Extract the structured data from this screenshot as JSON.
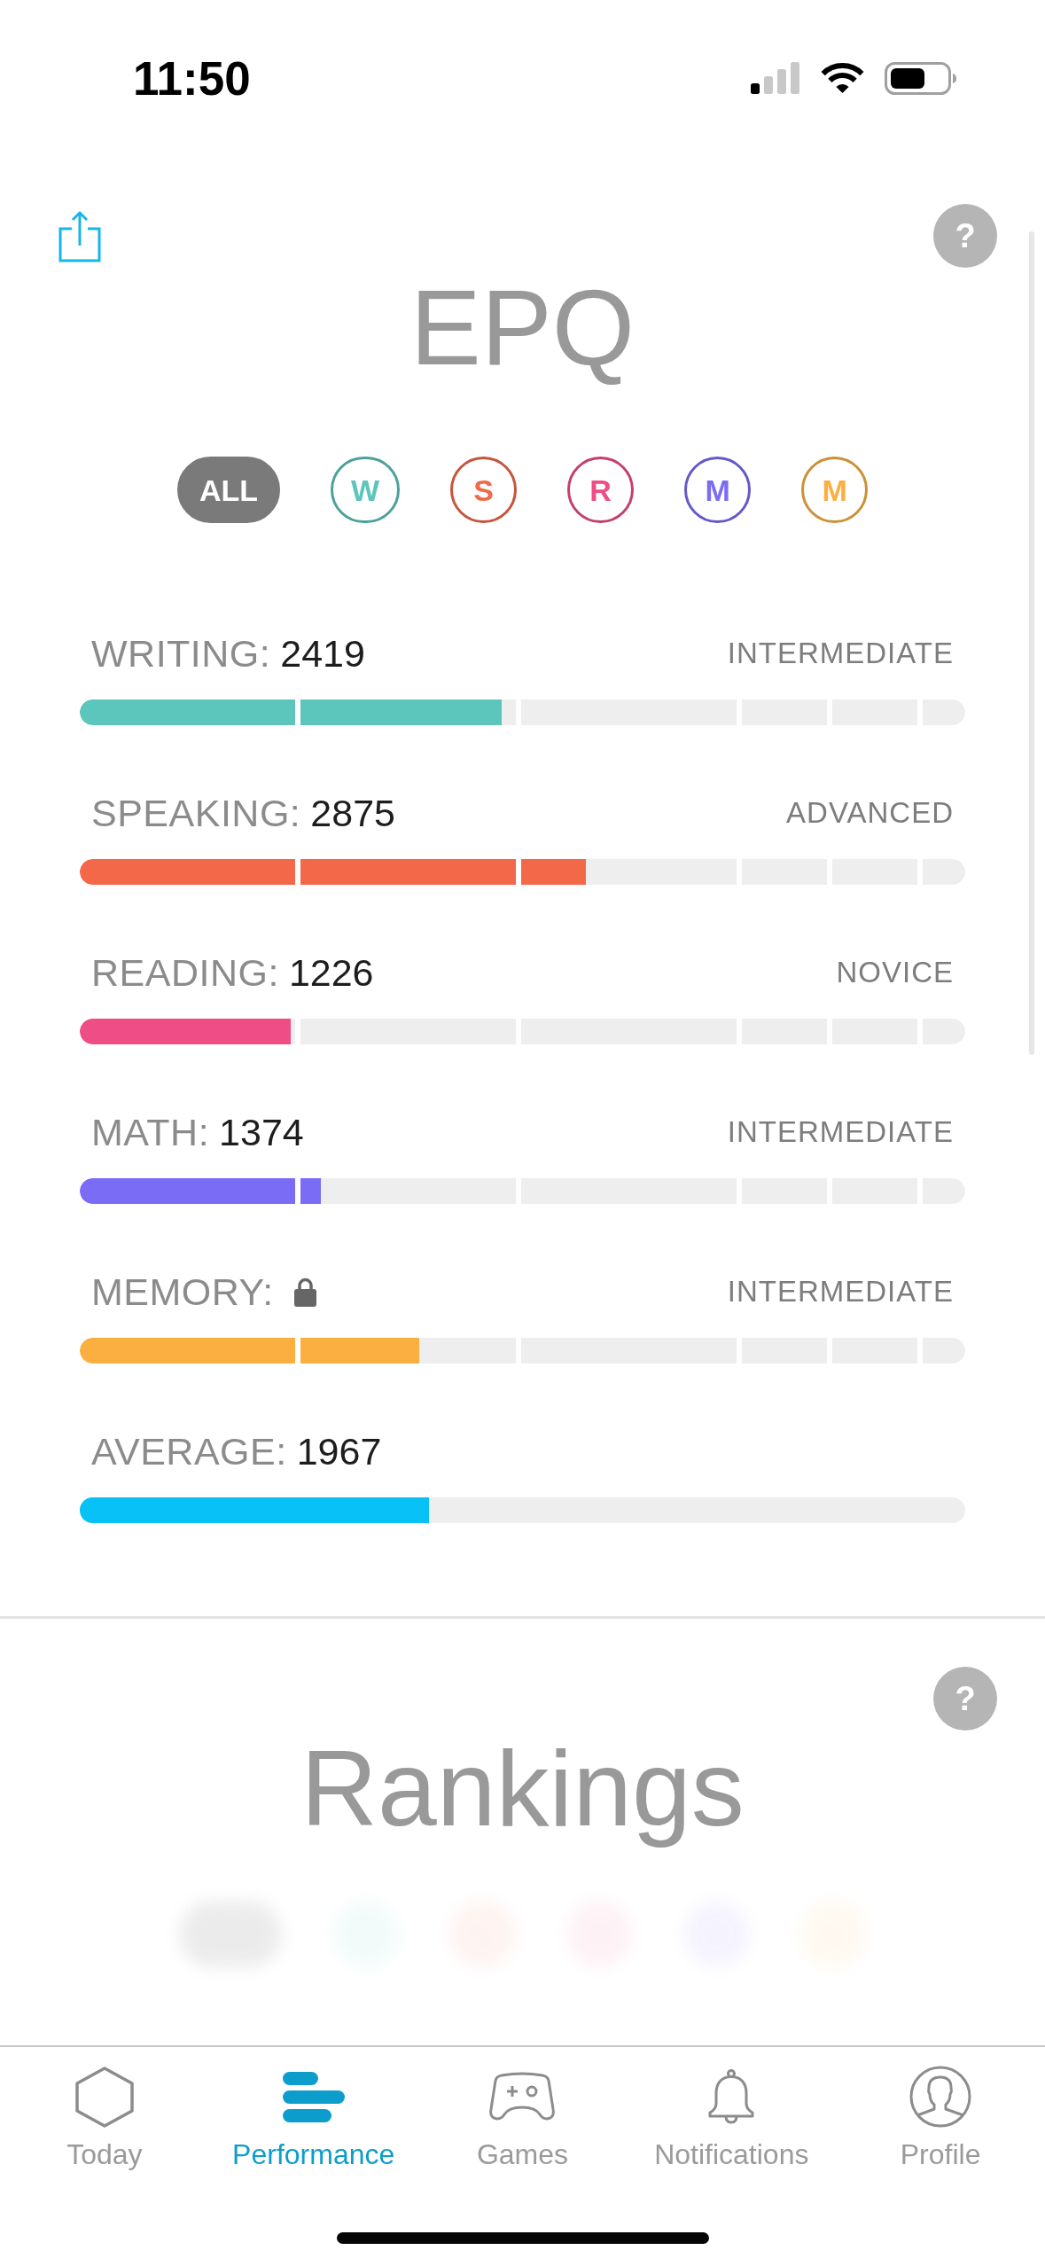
{
  "status_bar": {
    "time": "11:50"
  },
  "epq": {
    "title": "EPQ",
    "help": "?",
    "filters": [
      {
        "label": "ALL",
        "selected": true,
        "color": "#7a7a7a"
      },
      {
        "label": "W",
        "selected": false,
        "color": "#5cc5bc"
      },
      {
        "label": "S",
        "selected": false,
        "color": "#f26849"
      },
      {
        "label": "R",
        "selected": false,
        "color": "#ef4d86"
      },
      {
        "label": "M",
        "selected": false,
        "color": "#7b6cf6"
      },
      {
        "label": "M",
        "selected": false,
        "color": "#fbaf41"
      }
    ],
    "rows": [
      {
        "kind": "skill",
        "name": "WRITING:",
        "score": "2419",
        "rank": "INTERMEDIATE",
        "locked": false,
        "level": 0.476,
        "color": "#5cc5bc"
      },
      {
        "kind": "skill",
        "name": "SPEAKING:",
        "score": "2875",
        "rank": "ADVANCED",
        "locked": false,
        "level": 0.572,
        "color": "#f26849"
      },
      {
        "kind": "skill",
        "name": "READING:",
        "score": "1226",
        "rank": "NOVICE",
        "locked": false,
        "level": 0.238,
        "color": "#ef4d86"
      },
      {
        "kind": "skill",
        "name": "MATH:",
        "score": "1374",
        "rank": "INTERMEDIATE",
        "locked": false,
        "level": 0.272,
        "color": "#7b6cf6"
      },
      {
        "kind": "skill",
        "name": "MEMORY:",
        "rank": "INTERMEDIATE",
        "locked": true,
        "level": 0.383,
        "color": "#fbaf41"
      },
      {
        "kind": "average",
        "name": "AVERAGE:",
        "score": "1967",
        "locked": false,
        "level": 0.394,
        "color": "#08c1f7"
      }
    ]
  },
  "rankings": {
    "title": "Rankings",
    "help": "?"
  },
  "tab_bar": {
    "tabs": [
      {
        "label": "Today",
        "selected": false
      },
      {
        "label": "Performance",
        "selected": true
      },
      {
        "label": "Games",
        "selected": false
      },
      {
        "label": "Notifications",
        "selected": false
      },
      {
        "label": "Profile",
        "selected": false
      }
    ]
  }
}
